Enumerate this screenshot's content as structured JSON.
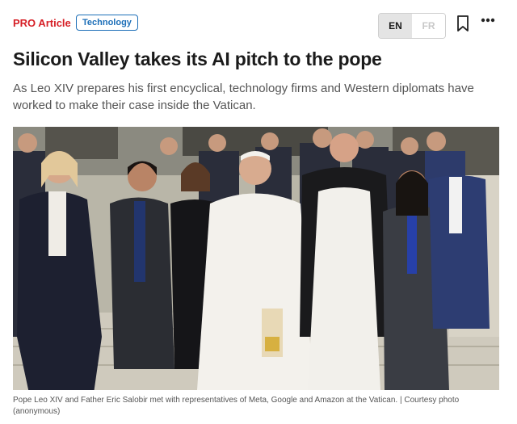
{
  "header": {
    "pro_label": "PRO Article",
    "tag": "Technology",
    "languages": {
      "active": "EN",
      "inactive": "FR"
    },
    "icons": {
      "save": "bookmark-icon",
      "menu": "more-icon"
    }
  },
  "article": {
    "headline": "Silicon Valley takes its AI pitch to the pope",
    "dek": "As Leo XIV prepares his first encyclical, technology firms and Western diplomats have worked to make their case inside the Vatican.",
    "caption": "Pope Leo XIV and Father Eric Salobir met with representatives of Meta, Google and Amazon at the Vatican. | Courtesy photo (anonymous)"
  },
  "colors": {
    "pro_red": "#d61f26",
    "tag_blue": "#1d6fb8",
    "headline": "#1b1b1b",
    "dek": "#555555"
  }
}
